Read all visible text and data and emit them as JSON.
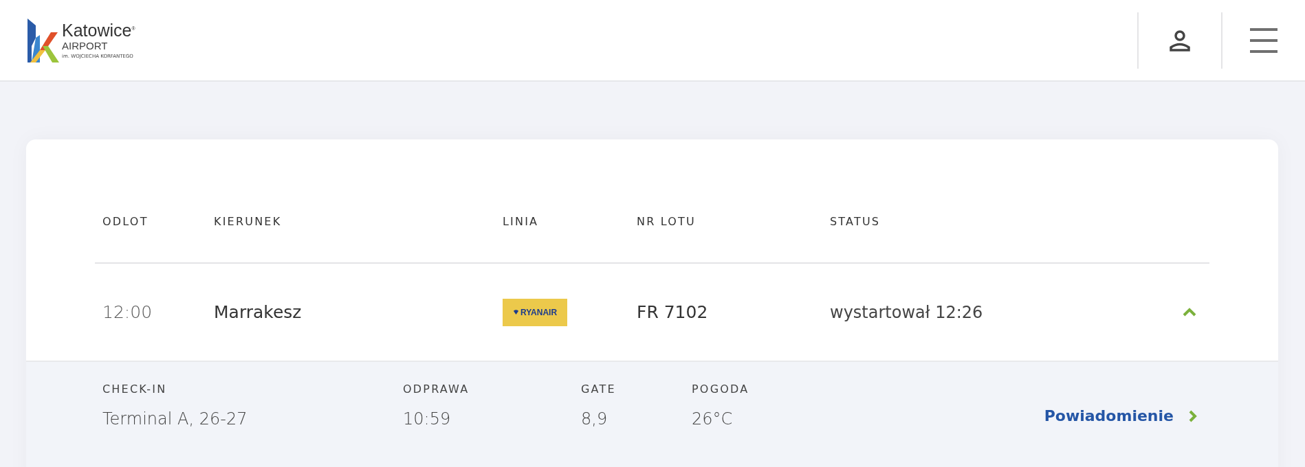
{
  "logo": {
    "name": "Katowice",
    "registered": "®",
    "subtitle": "AIRPORT",
    "patron": "im. WOJCIECHA KORFANTEGO"
  },
  "table": {
    "columns": [
      "ODLOT",
      "KIERUNEK",
      "LINIA",
      "NR LOTU",
      "STATUS"
    ],
    "rows": [
      {
        "time": "12:00",
        "destination": "Marrakesz",
        "airline": "RYANAIR",
        "flight": "FR 7102",
        "status": "wystartował 12:26",
        "expanded": true,
        "details": {
          "fields": [
            {
              "label": "CHECK-IN",
              "value": "Terminal A, 26-27"
            },
            {
              "label": "ODPRAWA",
              "value": "10:59"
            },
            {
              "label": "GATE",
              "value": "8,9"
            },
            {
              "label": "POGODA",
              "value": "26°C"
            }
          ],
          "link": "Powiadomienie"
        }
      }
    ]
  }
}
